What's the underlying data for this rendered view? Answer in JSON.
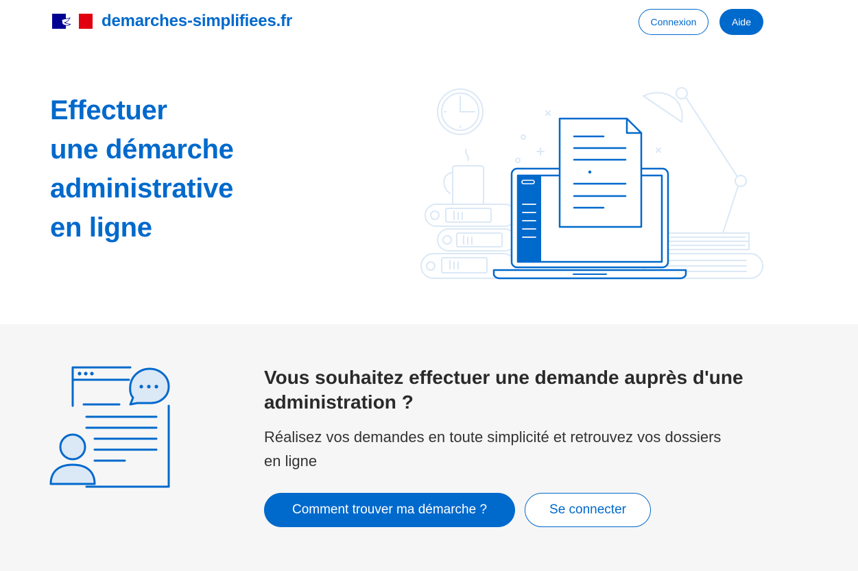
{
  "header": {
    "brand": "demarches-simplifiees.fr",
    "login_label": "Connexion",
    "help_label": "Aide"
  },
  "hero": {
    "title_lines": [
      "Effectuer",
      "une démarche",
      "administrative",
      "en ligne"
    ]
  },
  "band": {
    "title": "Vous souhaitez effectuer une demande auprès d'une administration ?",
    "subtitle": "Réalisez vos demandes en toute simplicité et retrouvez vos dossiers en ligne",
    "find_button": "Comment trouver ma démarche ?",
    "connect_button": "Se connecter"
  },
  "colors": {
    "primary": "#0069cc",
    "illustration_light": "#dbe8f6",
    "band_background": "#f6f6f6",
    "flag_blue": "#000091",
    "flag_red": "#e1000f"
  },
  "icons": {
    "flag": "marianne-flag-icon",
    "hero": "laptop-document-illustration",
    "band": "form-chat-user-illustration"
  }
}
